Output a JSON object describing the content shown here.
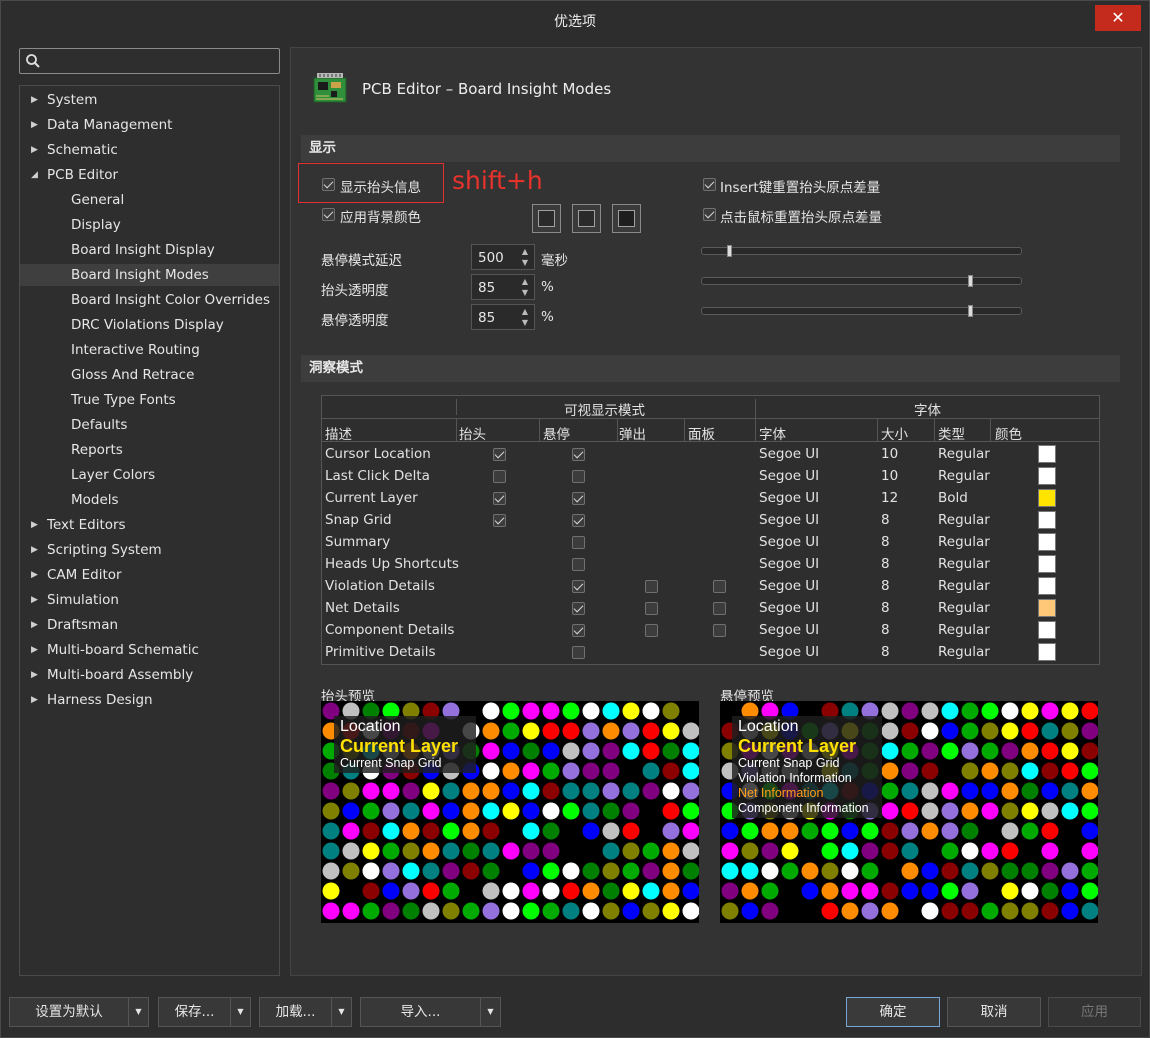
{
  "window": {
    "title": "优选项",
    "close_glyph": "✕"
  },
  "search": {
    "placeholder": ""
  },
  "tree": [
    {
      "label": "System",
      "level": 0,
      "arrow": "▶"
    },
    {
      "label": "Data Management",
      "level": 0,
      "arrow": "▶"
    },
    {
      "label": "Schematic",
      "level": 0,
      "arrow": "▶"
    },
    {
      "label": "PCB Editor",
      "level": 0,
      "arrow": "◢"
    },
    {
      "label": "General",
      "level": 1
    },
    {
      "label": "Display",
      "level": 1
    },
    {
      "label": "Board Insight Display",
      "level": 1
    },
    {
      "label": "Board Insight Modes",
      "level": 1,
      "selected": true
    },
    {
      "label": "Board Insight Color Overrides",
      "level": 1
    },
    {
      "label": "DRC Violations Display",
      "level": 1
    },
    {
      "label": "Interactive Routing",
      "level": 1
    },
    {
      "label": "Gloss And Retrace",
      "level": 1
    },
    {
      "label": "True Type Fonts",
      "level": 1
    },
    {
      "label": "Defaults",
      "level": 1
    },
    {
      "label": "Reports",
      "level": 1
    },
    {
      "label": "Layer Colors",
      "level": 1
    },
    {
      "label": "Models",
      "level": 1
    },
    {
      "label": "Text Editors",
      "level": 0,
      "arrow": "▶"
    },
    {
      "label": "Scripting System",
      "level": 0,
      "arrow": "▶"
    },
    {
      "label": "CAM Editor",
      "level": 0,
      "arrow": "▶"
    },
    {
      "label": "Simulation",
      "level": 0,
      "arrow": "▶"
    },
    {
      "label": "Draftsman",
      "level": 0,
      "arrow": "▶"
    },
    {
      "label": "Multi-board Schematic",
      "level": 0,
      "arrow": "▶"
    },
    {
      "label": "Multi-board Assembly",
      "level": 0,
      "arrow": "▶"
    },
    {
      "label": "Harness Design",
      "level": 0,
      "arrow": "▶"
    }
  ],
  "page": {
    "title": "PCB Editor – Board Insight Modes"
  },
  "display": {
    "section": "显示",
    "show_heads_up": {
      "label": "显示抬头信息",
      "checked": true
    },
    "use_bg_color": {
      "label": "应用背景颜色",
      "checked": true
    },
    "insert_reset": {
      "label": "Insert键重置抬头原点差量",
      "checked": true
    },
    "click_reset": {
      "label": "点击鼠标重置抬头原点差量",
      "checked": true
    },
    "annotation": "shift+h",
    "hover_delay": {
      "label": "悬停模式延迟",
      "value": "500",
      "unit": "毫秒",
      "level": 0.08
    },
    "heads_up_opacity": {
      "label": "抬头透明度",
      "value": "85",
      "unit": "%",
      "level": 0.85
    },
    "hover_opacity": {
      "label": "悬停透明度",
      "value": "85",
      "unit": "%",
      "level": 0.85
    },
    "swatch_colors": [
      "#2a2a2a",
      "#2a2a2a",
      "#1e1e1e"
    ]
  },
  "insight": {
    "section": "洞察模式",
    "group_visible": "可视显示模式",
    "group_font": "字体",
    "headers": [
      "描述",
      "抬头",
      "悬停",
      "弹出",
      "面板",
      "字体",
      "大小",
      "类型",
      "颜色"
    ],
    "rows": [
      {
        "desc": "Cursor Location",
        "headsup": "on",
        "hover": "on",
        "popup": "",
        "panel": "",
        "font": "Segoe UI",
        "size": "10",
        "type": "Regular",
        "color": "#ffffff"
      },
      {
        "desc": "Last Click Delta",
        "headsup": "off",
        "hover": "off",
        "popup": "",
        "panel": "",
        "font": "Segoe UI",
        "size": "10",
        "type": "Regular",
        "color": "#ffffff"
      },
      {
        "desc": "Current Layer",
        "headsup": "on",
        "hover": "on",
        "popup": "",
        "panel": "",
        "font": "Segoe UI",
        "size": "12",
        "type": "Bold",
        "color": "#ffe400"
      },
      {
        "desc": "Snap Grid",
        "headsup": "on",
        "hover": "on",
        "popup": "",
        "panel": "",
        "font": "Segoe UI",
        "size": "8",
        "type": "Regular",
        "color": "#ffffff"
      },
      {
        "desc": "Summary",
        "headsup": "",
        "hover": "off",
        "popup": "",
        "panel": "",
        "font": "Segoe UI",
        "size": "8",
        "type": "Regular",
        "color": "#ffffff"
      },
      {
        "desc": "Heads Up Shortcuts",
        "headsup": "",
        "hover": "off",
        "popup": "",
        "panel": "",
        "font": "Segoe UI",
        "size": "8",
        "type": "Regular",
        "color": "#ffffff"
      },
      {
        "desc": "Violation Details",
        "headsup": "",
        "hover": "on",
        "popup": "off",
        "panel": "off",
        "font": "Segoe UI",
        "size": "8",
        "type": "Regular",
        "color": "#ffffff"
      },
      {
        "desc": "Net Details",
        "headsup": "",
        "hover": "on",
        "popup": "off",
        "panel": "off",
        "font": "Segoe UI",
        "size": "8",
        "type": "Regular",
        "color": "#ffc878"
      },
      {
        "desc": "Component Details",
        "headsup": "",
        "hover": "on",
        "popup": "off",
        "panel": "off",
        "font": "Segoe UI",
        "size": "8",
        "type": "Regular",
        "color": "#ffffff"
      },
      {
        "desc": "Primitive Details",
        "headsup": "",
        "hover": "off",
        "popup": "",
        "panel": "",
        "font": "Segoe UI",
        "size": "8",
        "type": "Regular",
        "color": "#ffffff"
      }
    ]
  },
  "preview": {
    "headsup_title": "抬头预览",
    "hover_title": "悬停预览",
    "headsup_lines": [
      "Location",
      "Current Layer",
      "Current Snap Grid"
    ],
    "hover_lines": [
      "Location",
      "Current Layer",
      "Current Snap Grid",
      "Violation Information",
      "Net Information",
      "Component Information"
    ]
  },
  "buttons": {
    "set_default": "设置为默认",
    "save": "保存...",
    "load": "加载...",
    "import": "导入...",
    "ok": "确定",
    "cancel": "取消",
    "apply": "应用",
    "dropdown_glyph": "▼"
  }
}
